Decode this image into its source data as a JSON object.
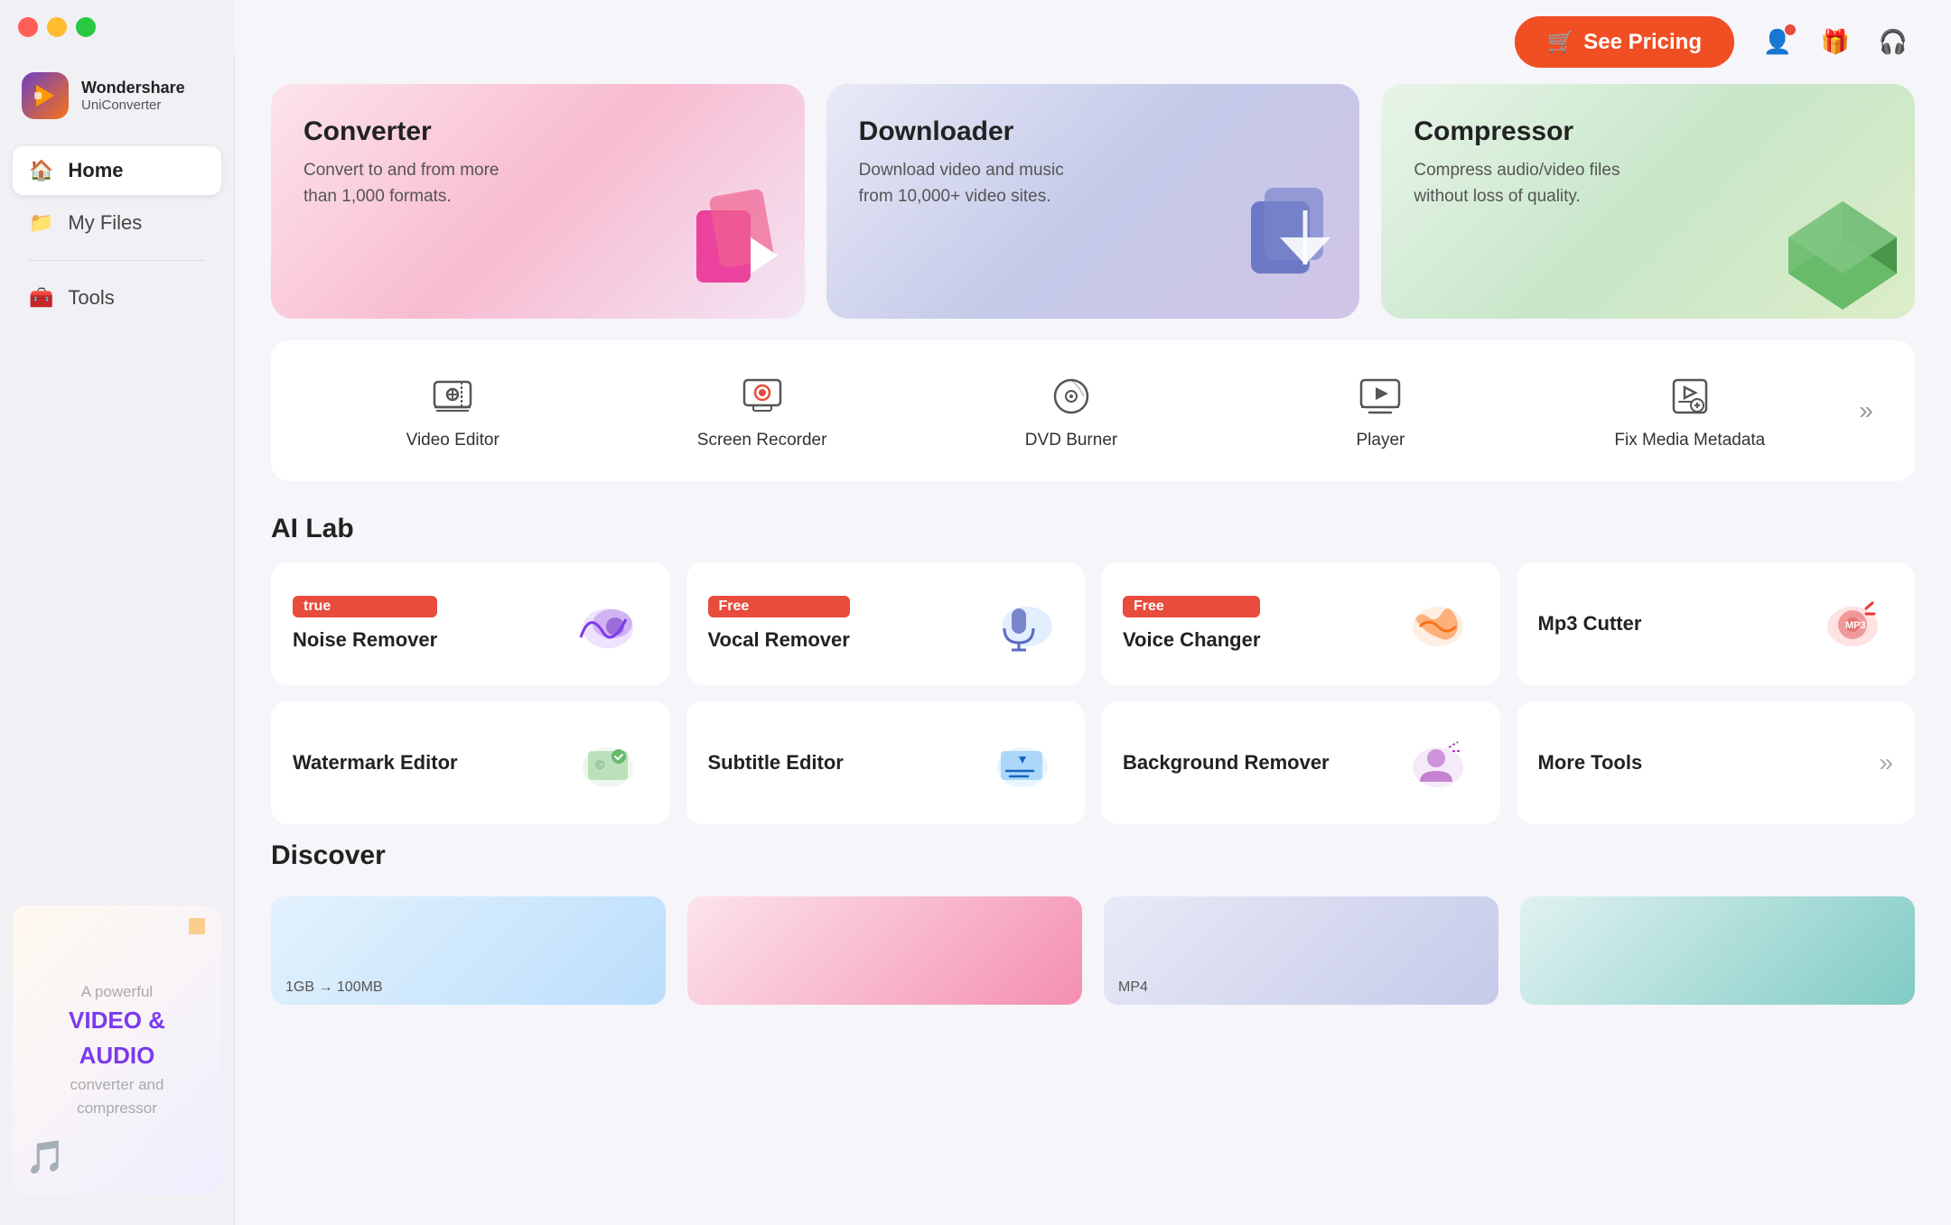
{
  "app": {
    "name": "Wondershare",
    "sub": "UniConverter"
  },
  "window": {
    "close": "close",
    "minimize": "minimize",
    "maximize": "maximize"
  },
  "header": {
    "see_pricing": "See Pricing",
    "user_icon": "👤",
    "gift_icon": "🎁",
    "headset_icon": "🎧"
  },
  "sidebar": {
    "items": [
      {
        "label": "Home",
        "icon": "🏠",
        "active": true
      },
      {
        "label": "My Files",
        "icon": "📁",
        "active": false
      },
      {
        "label": "Tools",
        "icon": "🧰",
        "active": false
      }
    ],
    "ad": {
      "line1": "A powerful",
      "line2": "VIDEO &",
      "line3": "AUDIO",
      "line4": "converter and",
      "line5": "compressor"
    }
  },
  "feature_cards": [
    {
      "title": "Converter",
      "desc": "Convert to and from more than 1,000 formats.",
      "color": "pink"
    },
    {
      "title": "Downloader",
      "desc": "Download video and music from 10,000+ video sites.",
      "color": "purple"
    },
    {
      "title": "Compressor",
      "desc": "Compress audio/video files without loss of quality.",
      "color": "green"
    }
  ],
  "tools": [
    {
      "label": "Video Editor",
      "icon": "✂"
    },
    {
      "label": "Screen Recorder",
      "icon": "🖥"
    },
    {
      "label": "DVD Burner",
      "icon": "💿"
    },
    {
      "label": "Player",
      "icon": "📺"
    },
    {
      "label": "Fix Media Metadata",
      "icon": "🔧"
    }
  ],
  "ai_lab": {
    "title": "AI Lab",
    "row1": [
      {
        "label": "Noise Remover",
        "free": true
      },
      {
        "label": "Vocal Remover",
        "free": true
      },
      {
        "label": "Voice Changer",
        "free": true
      },
      {
        "label": "Mp3 Cutter",
        "free": false
      }
    ],
    "row2": [
      {
        "label": "Watermark Editor",
        "free": false
      },
      {
        "label": "Subtitle Editor",
        "free": false
      },
      {
        "label": "Background Remover",
        "free": false
      }
    ],
    "more_tools": "More Tools"
  },
  "discover": {
    "title": "Discover"
  }
}
